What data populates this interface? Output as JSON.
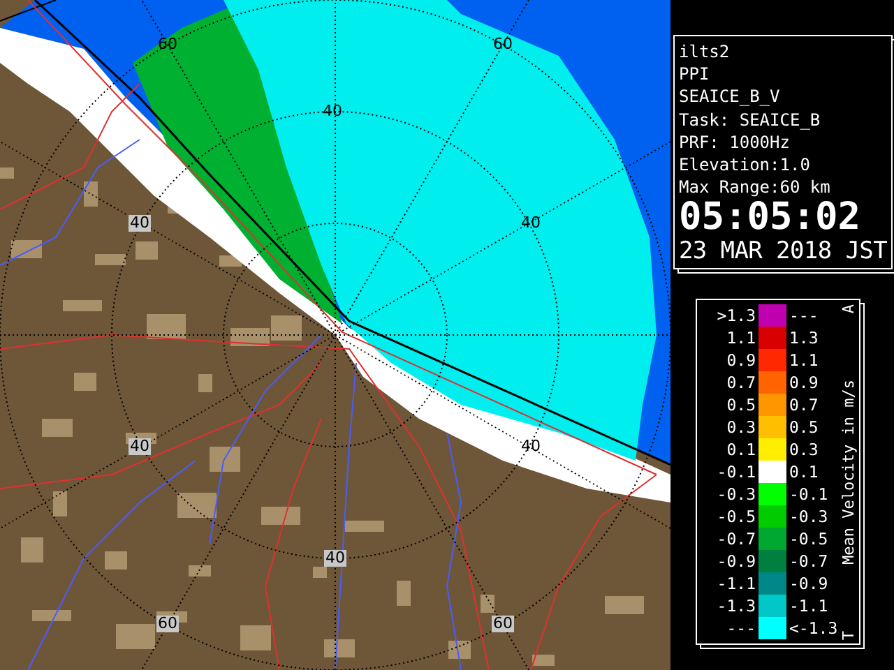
{
  "radar_map": {
    "range_labels": [
      {
        "text": "60",
        "boxed": false
      },
      {
        "text": "60",
        "boxed": false
      },
      {
        "text": "40",
        "boxed": false
      },
      {
        "text": "40",
        "boxed": true
      },
      {
        "text": "40",
        "boxed": false
      },
      {
        "text": "40",
        "boxed": true
      },
      {
        "text": "40",
        "boxed": false
      },
      {
        "text": "40",
        "boxed": true
      },
      {
        "text": "60",
        "boxed": true
      },
      {
        "text": "60",
        "boxed": true
      }
    ]
  },
  "info_panel": {
    "lines": [
      "ilts2",
      "PPI",
      "SEAICE_B_V",
      "Task: SEAICE_B",
      "PRF: 1000Hz",
      "Elevation:1.0",
      "Max Range:60 km"
    ],
    "time": "05:05:02",
    "date": "23 MAR 2018 JST"
  },
  "legend": {
    "top_mark": "A",
    "bottom_mark": "T",
    "title": "Mean Velocity in m/s",
    "rows": [
      {
        "low": ">1.3",
        "high": "---",
        "color": "#c000b0"
      },
      {
        "low": "1.1",
        "high": "1.3",
        "color": "#d80000"
      },
      {
        "low": "0.9",
        "high": "1.1",
        "color": "#ff2800"
      },
      {
        "low": "0.7",
        "high": "0.9",
        "color": "#ff6400"
      },
      {
        "low": "0.5",
        "high": "0.7",
        "color": "#ff9600"
      },
      {
        "low": "0.3",
        "high": "0.5",
        "color": "#ffbe00"
      },
      {
        "low": "0.1",
        "high": "0.3",
        "color": "#ffee00"
      },
      {
        "low": "-0.1",
        "high": "0.1",
        "color": "#ffffff"
      },
      {
        "low": "-0.3",
        "high": "-0.1",
        "color": "#00ff00"
      },
      {
        "low": "-0.5",
        "high": "-0.3",
        "color": "#00cc00"
      },
      {
        "low": "-0.7",
        "high": "-0.5",
        "color": "#00a830"
      },
      {
        "low": "-0.9",
        "high": "-0.7",
        "color": "#008040"
      },
      {
        "low": "-1.1",
        "high": "-0.9",
        "color": "#008888"
      },
      {
        "low": "-1.3",
        "high": "-1.1",
        "color": "#00c8c8"
      },
      {
        "low": "---",
        "high": "<-1.3",
        "color": "#00ffff"
      }
    ]
  }
}
